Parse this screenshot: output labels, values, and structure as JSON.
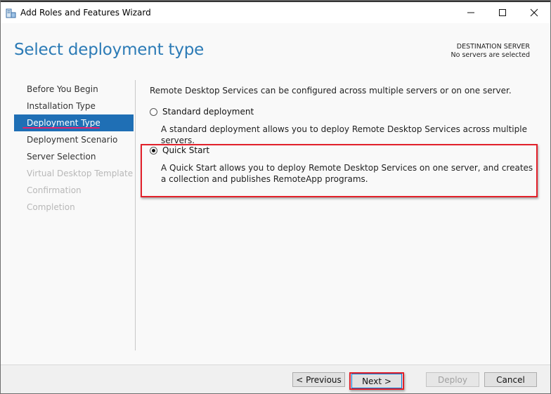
{
  "window": {
    "title": "Add Roles and Features Wizard"
  },
  "header": {
    "page_title": "Select deployment type",
    "destination_label": "DESTINATION SERVER",
    "destination_value": "No servers are selected"
  },
  "nav": {
    "items": [
      {
        "label": "Before You Begin",
        "state": "enabled"
      },
      {
        "label": "Installation Type",
        "state": "enabled"
      },
      {
        "label": "Deployment Type",
        "state": "active"
      },
      {
        "label": "Deployment Scenario",
        "state": "enabled"
      },
      {
        "label": "Server Selection",
        "state": "enabled"
      },
      {
        "label": "Virtual Desktop Template",
        "state": "disabled"
      },
      {
        "label": "Confirmation",
        "state": "disabled"
      },
      {
        "label": "Completion",
        "state": "disabled"
      }
    ]
  },
  "main": {
    "intro": "Remote Desktop Services can be configured across multiple servers or on one server.",
    "options": [
      {
        "label": "Standard deployment",
        "checked": false,
        "description": "A standard deployment allows you to deploy Remote Desktop Services across multiple servers."
      },
      {
        "label": "Quick Start",
        "checked": true,
        "description": "A Quick Start allows you to deploy Remote Desktop Services on one server, and creates a collection and publishes RemoteApp programs."
      }
    ]
  },
  "footer": {
    "previous_label": "< Previous",
    "next_label": "Next >",
    "deploy_label": "Deploy",
    "cancel_label": "Cancel"
  },
  "colors": {
    "accent": "#1f6fb5",
    "title_blue": "#2c7bb6",
    "annotation_red": "#e2202a",
    "underline_pink": "#e2216f"
  },
  "icons": {
    "app": "server-manager-icon",
    "minimize": "minimize-icon",
    "maximize": "maximize-icon",
    "close": "close-icon"
  }
}
